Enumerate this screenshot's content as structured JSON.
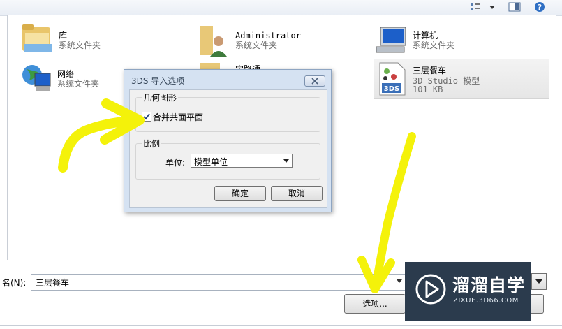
{
  "toolbar": {
    "icons": [
      "view-options-icon",
      "chevron-down-icon",
      "preview-pane-icon",
      "help-icon"
    ],
    "help_glyph": "?"
  },
  "files": [
    {
      "name": "库",
      "subtitle": "系统文件夹",
      "icon": "library-folder-icon"
    },
    {
      "name": "Administrator",
      "subtitle": "系统文件夹",
      "icon": "user-folder-icon"
    },
    {
      "name": "计算机",
      "subtitle": "系统文件夹",
      "icon": "computer-icon"
    },
    {
      "name": "网络",
      "subtitle": "系统文件夹",
      "icon": "network-globe-icon"
    },
    {
      "name": "宝路通",
      "subtitle": "",
      "icon": "folder-icon"
    },
    {
      "name": "三层餐车",
      "subtitle": "3D Studio 模型",
      "size": "101 KB",
      "icon": "3ds-file-icon",
      "icon_text": "3DS",
      "selected": true
    }
  ],
  "dialog": {
    "title": "3DS 导入选项",
    "geometry_group": {
      "title": "几何图形",
      "merge_coplanar": {
        "label": "合并共面平面",
        "checked": true
      }
    },
    "scale_group": {
      "title": "比例",
      "unit_label": "单位:",
      "unit_value": "模型单位"
    },
    "ok_label": "确定",
    "cancel_label": "取消"
  },
  "bottom": {
    "filename_label": "名(N):",
    "filename_value": "三层餐车",
    "options_label": "选项..."
  },
  "watermark": {
    "title": "溜溜自学",
    "url": "ZIXUE.3D66.COM"
  },
  "colors": {
    "annotation": "#f4f20a",
    "watermark_bg": "#2b3b4d",
    "dialog_frame": "#d5e2f2"
  }
}
